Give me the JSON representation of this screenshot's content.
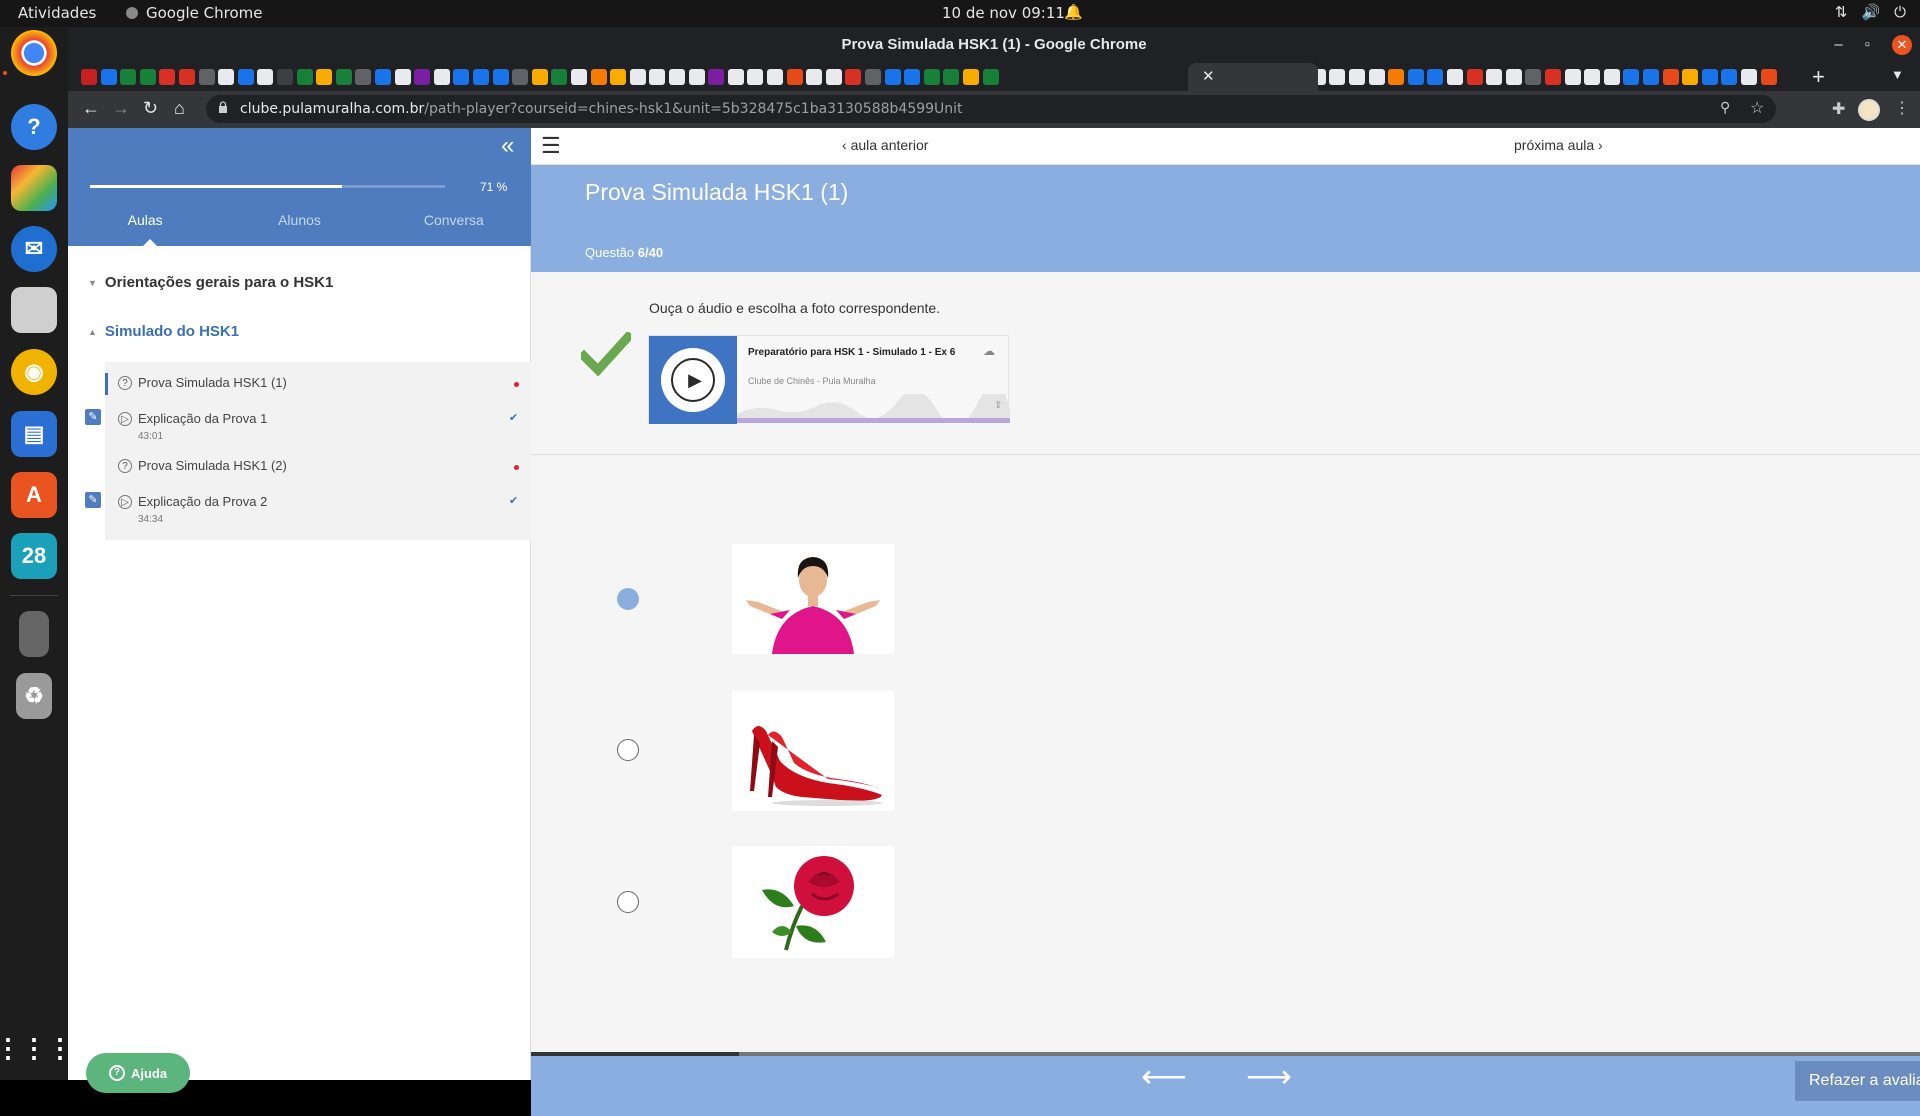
{
  "system": {
    "activities": "Atividades",
    "app_name": "Google Chrome",
    "clock": "10 de nov  09:11"
  },
  "dock": {
    "calendar_day": "28",
    "apps": [
      "chrome-icon",
      "help-icon",
      "3d-icon",
      "thunderbird-icon",
      "files-icon",
      "rhythmbox-icon",
      "writer-icon",
      "software-icon",
      "calendar-icon",
      "phone-icon",
      "trash-icon",
      "apps-grid-icon"
    ]
  },
  "browser": {
    "window_title": "Prova Simulada HSK1 (1) - Google Chrome",
    "url_host": "clube.pulamuralha.com.br",
    "url_path": "/path-player?courseid=chines-hsk1&unit=5b328475c1ba3130588b4599Unit"
  },
  "sidebar": {
    "progress_label": "71 %",
    "progress_fraction": 0.71,
    "tabs": [
      "Aulas",
      "Alunos",
      "Conversa"
    ],
    "sections": [
      {
        "title": "Orientações gerais para o HSK1"
      },
      {
        "title": "Simulado do HSK1"
      }
    ],
    "lessons": [
      {
        "title": "Prova Simulada HSK1 (1)",
        "duration": ""
      },
      {
        "title": "Explicação da Prova 1",
        "duration": "43:01"
      },
      {
        "title": "Prova Simulada HSK1 (2)",
        "duration": ""
      },
      {
        "title": "Explicação da Prova 2",
        "duration": "34:34"
      }
    ],
    "help_label": "Ajuda"
  },
  "content": {
    "prev_label": "aula anterior",
    "next_label": "próxima aula",
    "title": "Prova Simulada HSK1 (1)",
    "question_label": "Questão",
    "question_number": "6/40",
    "prompt": "Ouça o áudio e escolha a foto correspondente.",
    "player": {
      "track_title": "Preparatório para HSK 1 - Simulado 1 - Ex 6",
      "author": "Clube de Chinês - Pula Muralha"
    },
    "options": [
      {
        "image": "woman-shrugging-photo",
        "selected": true
      },
      {
        "image": "red-high-heels-photo",
        "selected": false
      },
      {
        "image": "red-rose-photo",
        "selected": false
      }
    ],
    "footer": {
      "progress_fraction": 0.15,
      "redo_label": "Refazer a avaliação?"
    }
  },
  "colors": {
    "accent_blue": "#4e7cbf",
    "header_blue": "#8aaee0",
    "correct_green": "#6aa84f",
    "help_green": "#5bb57d"
  }
}
